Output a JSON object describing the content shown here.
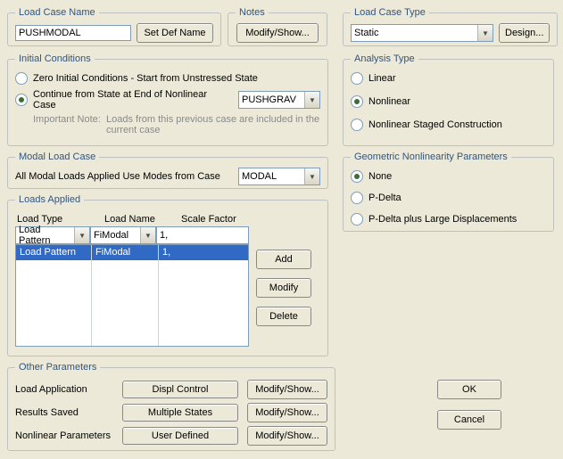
{
  "groups": {
    "loadCaseName": "Load Case Name",
    "notes": "Notes",
    "loadCaseType": "Load Case Type",
    "initialConditions": "Initial Conditions",
    "analysisType": "Analysis Type",
    "modalLoadCase": "Modal Load Case",
    "geomNonlin": "Geometric Nonlinearity Parameters",
    "loadsApplied": "Loads Applied",
    "otherParameters": "Other Parameters"
  },
  "loadCaseName": {
    "value": "PUSHMODAL",
    "setDefButton": "Set Def Name"
  },
  "notes": {
    "button": "Modify/Show..."
  },
  "loadCaseType": {
    "selected": "Static",
    "designButton": "Design..."
  },
  "initialConditions": {
    "optZero": "Zero Initial Conditions - Start from Unstressed State",
    "optContinue": "Continue from State at End of Nonlinear Case",
    "continueCase": "PUSHGRAV",
    "noteLabel": "Important Note:",
    "noteText1": "Loads from this previous case are included in the",
    "noteText2": "current case",
    "selected": "continue"
  },
  "analysisType": {
    "linear": "Linear",
    "nonlinear": "Nonlinear",
    "staged": "Nonlinear Staged Construction",
    "selected": "nonlinear"
  },
  "modalLoadCase": {
    "label": "All Modal Loads Applied Use Modes from Case",
    "selected": "MODAL"
  },
  "geomNonlin": {
    "none": "None",
    "pdelta": "P-Delta",
    "pdeltal": "P-Delta plus Large Displacements",
    "selected": "none"
  },
  "loadsApplied": {
    "headers": {
      "type": "Load Type",
      "name": "Load Name",
      "scale": "Scale Factor"
    },
    "editorType": "Load Pattern",
    "editorName": "FiModal",
    "editorScale": "1,",
    "row0": {
      "type": "Load Pattern",
      "name": "FiModal",
      "scale": "1,"
    },
    "buttons": {
      "add": "Add",
      "modify": "Modify",
      "delete": "Delete"
    }
  },
  "otherParams": {
    "loadApplication": {
      "label": "Load Application",
      "value": "Displ Control",
      "button": "Modify/Show..."
    },
    "resultsSaved": {
      "label": "Results Saved",
      "value": "Multiple States",
      "button": "Modify/Show..."
    },
    "nonlinear": {
      "label": "Nonlinear Parameters",
      "value": "User Defined",
      "button": "Modify/Show..."
    }
  },
  "dialogButtons": {
    "ok": "OK",
    "cancel": "Cancel"
  }
}
